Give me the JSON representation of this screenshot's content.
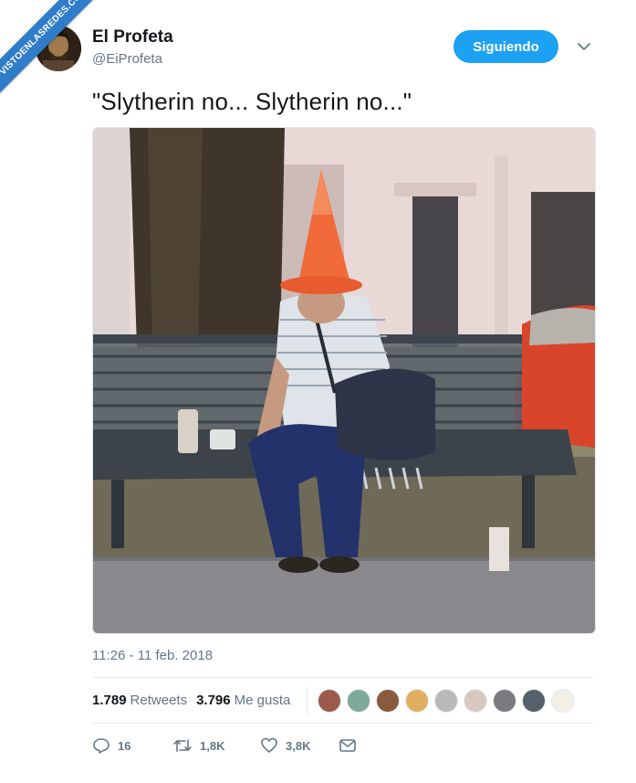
{
  "watermark": {
    "text": "VISTOENLASREDES.COM"
  },
  "author": {
    "display_name": "El Profeta",
    "handle": "@EiProfeta",
    "avatar_icon": "profile-photo"
  },
  "follow_button": {
    "label": "Siguiendo",
    "color": "#1da1f2"
  },
  "tweet": {
    "text": "\"Slytherin no... Slytherin no...\"",
    "timestamp": "11:26 - 11 feb. 2018"
  },
  "engagement": {
    "retweets_count": "1.789",
    "retweets_label": "Retweets",
    "likes_count": "3.796",
    "likes_label": "Me gusta",
    "liker_avatars": [
      "#9b5a4a",
      "#7fa99a",
      "#8a5a3c",
      "#e0b060",
      "#b9b9b9",
      "#d8c8c0",
      "#7a7a80",
      "#55606a",
      "#f2efe4"
    ]
  },
  "actions": {
    "replies": "16",
    "retweets": "1,8K",
    "likes": "3,8K"
  },
  "colors": {
    "accent": "#1da1f2",
    "muted": "#657786",
    "text": "#14171a"
  }
}
